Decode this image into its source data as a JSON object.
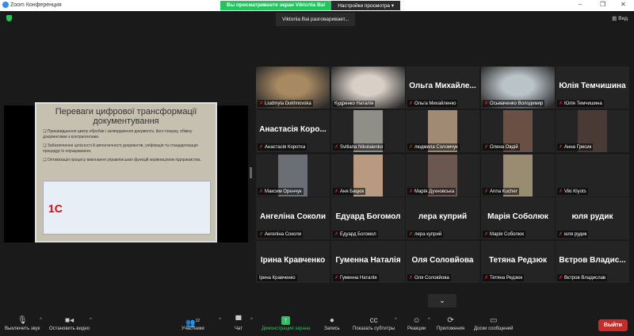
{
  "titlebar": {
    "app_title": "Zoom Конференция",
    "viewing_banner": "Вы просматриваете экран Viktoriia Bai",
    "view_options": "Настройки просмотра ▾",
    "minimize": "–",
    "restore": "❐",
    "close": "✕"
  },
  "header": {
    "talking": "Viktoriia Bai разговаривает...",
    "view_label": "▥ Вид"
  },
  "slide": {
    "title": "Переваги цифрової трансформації документування",
    "bullets": [
      "Пришвидшення циклу обробки і затвердження документа, його пошуку, обміну документами з контрагентами.",
      "Забезпечення цілісності й автентичності документів, уніфікація та стандартизація процедур їх опрацювання.",
      "Оптимізація процесу виконання управлінських функцій керівництвом підприємства."
    ],
    "logo": "1С"
  },
  "participants": [
    {
      "name": "Liudmyla Dukhnovska",
      "video": "#a88a62",
      "muted": true
    },
    {
      "name": "Кудренко Наталія",
      "video": "#d8cfc6",
      "muted": false
    },
    {
      "name": "Ольга Михайленко",
      "big": "Ольга Михайле...",
      "muted": true
    },
    {
      "name": "Осьмаченко Володимир",
      "video": "#b9c3c8",
      "muted": true
    },
    {
      "name": "Юлія Темчишина",
      "big": "Юлія Темчишина",
      "muted": true
    },
    {
      "name": "Анастасія Коротка",
      "big": "Анастасія Коро...",
      "muted": true
    },
    {
      "name": "Svitlana Nikolaienko",
      "video": "#8f8f88",
      "muted": true
    },
    {
      "name": "людмила Соломчук",
      "video": "#a08a74",
      "muted": true
    },
    {
      "name": "Олена Овдій",
      "video": "#6a4f44",
      "muted": true
    },
    {
      "name": "Анна Грисик",
      "video": "#4a3a35",
      "muted": true
    },
    {
      "name": "Максим Оренчук",
      "video": "#6b6e74",
      "muted": true
    },
    {
      "name": "Аня Бицюк",
      "video": "#b79a80",
      "muted": true
    },
    {
      "name": "Марія Духновська",
      "video": "#6a5850",
      "muted": true
    },
    {
      "name": "Anna Kucher",
      "video": "#9a8c70",
      "muted": true
    },
    {
      "name": "Viki Klyots",
      "muted": true
    },
    {
      "name": "Ангеліна Соколи",
      "big": "Ангеліна Соколи",
      "muted": true
    },
    {
      "name": "Едуард Богомол",
      "big": "Едуард Богомол",
      "muted": true
    },
    {
      "name": "лера куприй",
      "big": "лера куприй",
      "muted": true
    },
    {
      "name": "Марія Соболюк",
      "big": "Марія Соболюк",
      "muted": true
    },
    {
      "name": "юля рудик",
      "big": "юля рудик",
      "muted": true
    },
    {
      "name": "Ірина Кравченко",
      "big": "Ірина Кравченко",
      "muted": false
    },
    {
      "name": "Гуменна Наталія",
      "big": "Гуменна Наталія",
      "muted": true
    },
    {
      "name": "Оля Соловйова",
      "big": "Оля Соловйова",
      "muted": true
    },
    {
      "name": "Тетяна Редзюк",
      "big": "Тетяна Редзюк",
      "muted": true
    },
    {
      "name": "Вєтров Владислав",
      "big": "Вєтров Владис...",
      "muted": true
    }
  ],
  "toolbar": {
    "mute": "Выключить звук",
    "video": "Остановить видео",
    "participants": "Участники",
    "participants_count": "32",
    "chat": "Чат",
    "share": "Демонстрация экрана",
    "record": "Запись",
    "captions": "Показать субтитры",
    "reactions": "Реакции",
    "apps": "Приложения",
    "whiteboards": "Доски сообщений",
    "leave": "Выйти"
  },
  "colors": {
    "accent_green": "#23c55e",
    "leave_red": "#c92a2a",
    "mute_red": "#e02828"
  }
}
